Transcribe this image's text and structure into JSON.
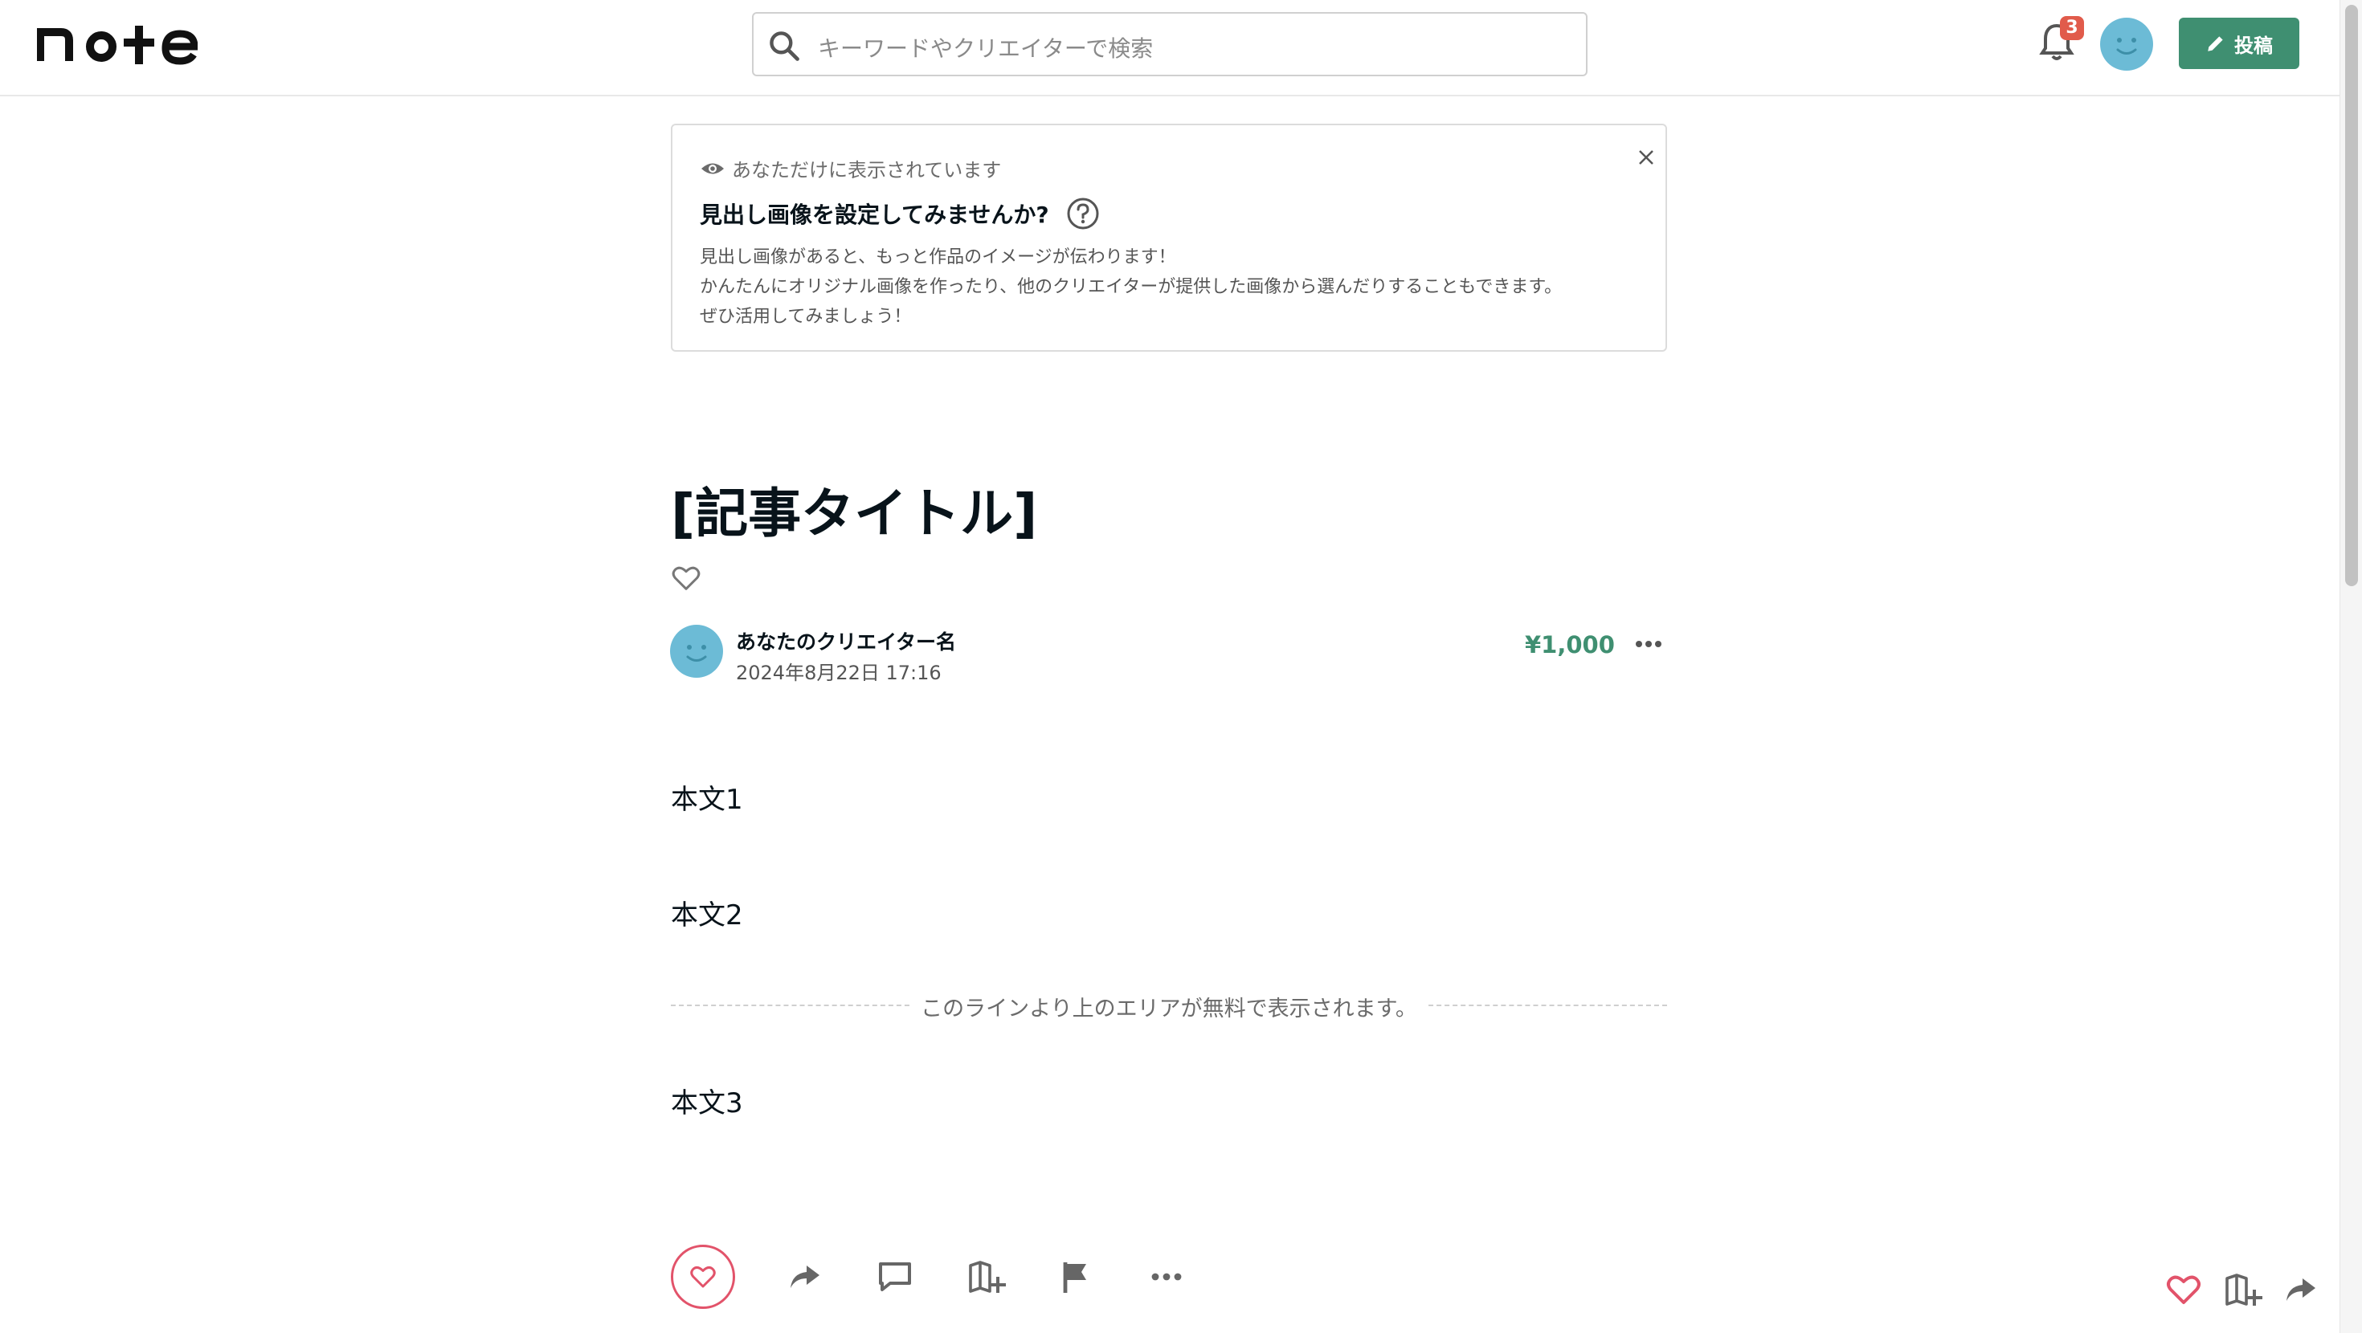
{
  "header": {
    "logo_text": "note",
    "search_placeholder": "キーワードやクリエイターで検索",
    "notification_count": "3",
    "post_button_label": "投稿"
  },
  "notice": {
    "visibility_text": "あなただけに表示されています",
    "heading": "見出し画像を設定してみませんか?",
    "description_lines": [
      "見出し画像があると、もっと作品のイメージが伝わります！",
      "かんたんにオリジナル画像を作ったり、他のクリエイターが提供した画像から選んだりすることもできます。",
      "ぜひ活用してみましょう！"
    ]
  },
  "article": {
    "title": "[記事タイトル]",
    "author_name": "あなたのクリエイター名",
    "date": "2024年8月22日 17:16",
    "price": "¥1,000",
    "body_paragraphs": [
      "本文1",
      "本文2"
    ],
    "free_line_text": "このラインより上のエリアが無料で表示されます。",
    "paid_paragraphs": [
      "本文3"
    ]
  },
  "colors": {
    "accent_green": "#3f8f71",
    "like_red": "#e2536a",
    "badge_red": "#e15b4b",
    "avatar_blue": "#6cbbd6"
  },
  "icons": [
    "search-icon",
    "bell-icon",
    "pencil-icon",
    "eye-icon",
    "close-icon",
    "help-icon",
    "heart-icon",
    "share-icon",
    "comment-icon",
    "magazine-add-icon",
    "flag-icon",
    "more-icon"
  ]
}
